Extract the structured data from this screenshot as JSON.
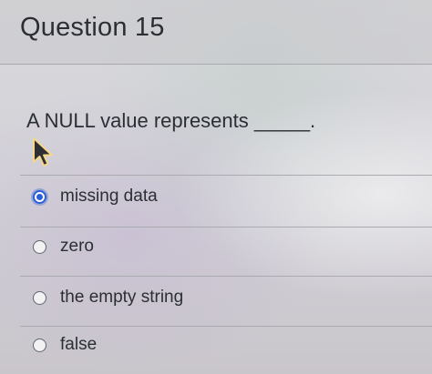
{
  "question": {
    "title": "Question 15",
    "text": "A NULL value represents _____."
  },
  "answers": [
    {
      "label": "missing data",
      "selected": true
    },
    {
      "label": "zero",
      "selected": false
    },
    {
      "label": "the empty string",
      "selected": false
    },
    {
      "label": "false",
      "selected": false
    }
  ],
  "colors": {
    "selected_radio": "#2c5fd6",
    "text": "#2b2f33",
    "divider": "#a9abb0"
  },
  "icons": {
    "pointer": "mouse-pointer-icon"
  }
}
